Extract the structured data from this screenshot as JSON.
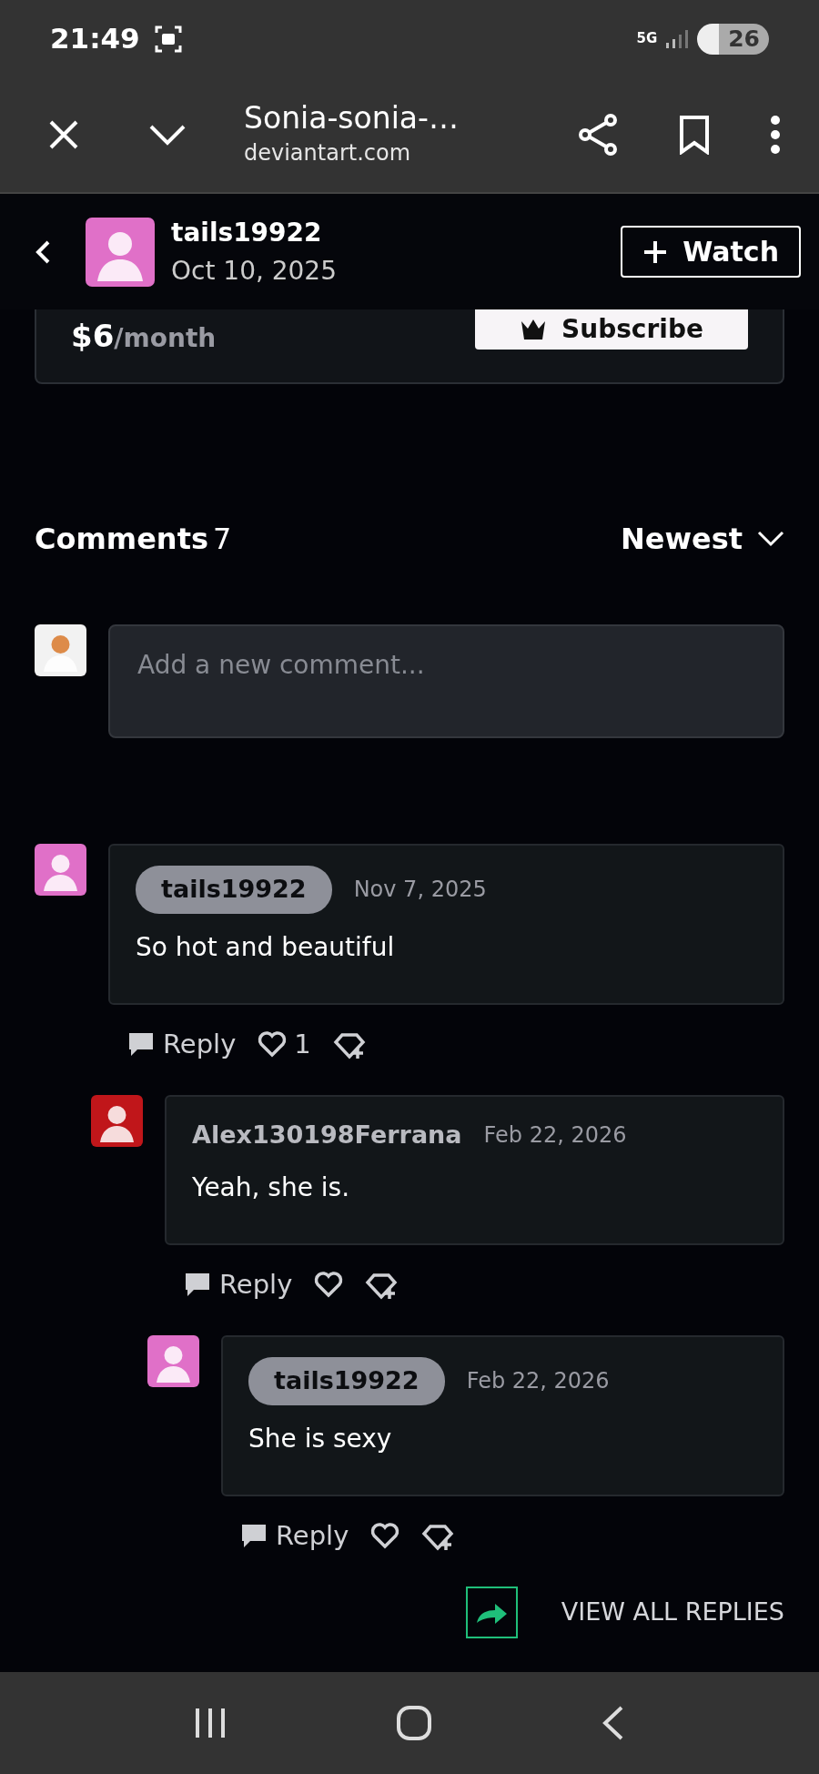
{
  "status_bar": {
    "time": "21:49",
    "network": "5G",
    "battery": "26"
  },
  "browser_bar": {
    "title": "Sonia-sonia-…",
    "url": "deviantart.com"
  },
  "header": {
    "author": "tails19922",
    "date": "Oct 10, 2025",
    "watch_button": "Watch"
  },
  "subscription": {
    "price": "$6",
    "period": "/month",
    "button": "Subscribe"
  },
  "comments": {
    "title": "Comments",
    "count": "7",
    "sort": "Newest",
    "input": {
      "placeholder": "Add a new comment..."
    },
    "items": [
      {
        "author": "tails19922",
        "is_artist": true,
        "date": "Nov 7, 2025",
        "text": "So hot and beautiful",
        "reply": "Reply",
        "likes": "1",
        "color": "#e070c8",
        "children": [
          {
            "author": "Alex130198Ferrana",
            "is_artist": false,
            "date": "Feb 22, 2026",
            "text": "Yeah, she is.",
            "reply": "Reply",
            "color": "#c0161a",
            "children": [
              {
                "author": "tails19922",
                "is_artist": true,
                "date": "Feb 22, 2026",
                "text": "She is sexy",
                "reply": "Reply",
                "color": "#e070c8"
              }
            ]
          }
        ]
      }
    ],
    "view_all": "VIEW ALL REPLIES"
  }
}
